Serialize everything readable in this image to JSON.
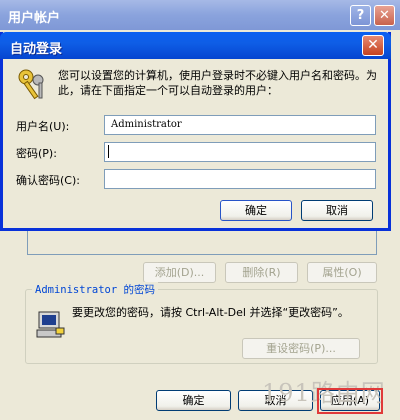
{
  "bg_window": {
    "title": "用户帐户",
    "help_glyph": "?",
    "close_glyph": "✕",
    "buttons": {
      "add": "添加(D)...",
      "remove": "删除(R)",
      "properties": "属性(O)"
    },
    "password_group": {
      "title": "Administrator 的密码",
      "text": "要更改您的密码，请按 Ctrl-Alt-Del 并选择“更改密码”。",
      "reset_button": "重设密码(P)..."
    },
    "footer": {
      "ok": "确定",
      "cancel": "取消",
      "apply": "应用(A)"
    },
    "watermark": "191路由网"
  },
  "dialog": {
    "title": "自动登录",
    "close_glyph": "✕",
    "description": "您可以设置您的计算机，使用户登录时不必键入用户名和密码。为此，请在下面指定一个可以自动登录的用户：",
    "username_label": "用户名(U):",
    "username_value": "Administrator",
    "password_label": "密码(P):",
    "password_value": "",
    "confirm_label": "确认密码(C):",
    "confirm_value": "",
    "ok": "确定",
    "cancel": "取消"
  },
  "colors": {
    "title_blue": "#0a5ff2",
    "highlight_red": "#e03a3a",
    "group_title_blue": "#0046d5"
  }
}
